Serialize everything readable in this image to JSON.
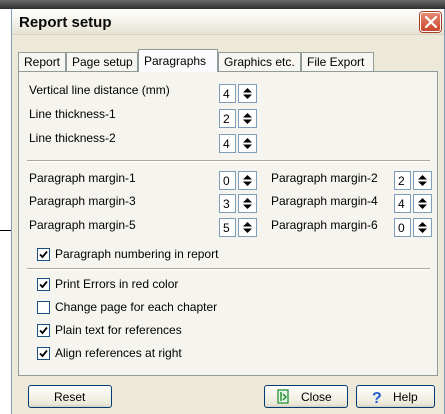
{
  "window": {
    "title": "Report setup"
  },
  "tabs": [
    {
      "label": "Report"
    },
    {
      "label": "Page setup"
    },
    {
      "label": "Paragraphs"
    },
    {
      "label": "Graphics etc."
    },
    {
      "label": "File Export"
    }
  ],
  "line_settings": [
    {
      "label": "Vertical line distance (mm)",
      "value": "4"
    },
    {
      "label": "Line thickness-1",
      "value": "2"
    },
    {
      "label": "Line thickness-2",
      "value": "4"
    }
  ],
  "margins": [
    {
      "label": "Paragraph margin-1",
      "value": "0"
    },
    {
      "label": "Paragraph margin-2",
      "value": "2"
    },
    {
      "label": "Paragraph margin-3",
      "value": "3"
    },
    {
      "label": "Paragraph margin-4",
      "value": "4"
    },
    {
      "label": "Paragraph margin-5",
      "value": "5"
    },
    {
      "label": "Paragraph margin-6",
      "value": "0"
    }
  ],
  "numbering": {
    "label": "Paragraph numbering in report",
    "checked": true
  },
  "options": [
    {
      "label": "Print Errors in red color",
      "checked": true
    },
    {
      "label": "Change page for each chapter",
      "checked": false
    },
    {
      "label": "Plain text for references",
      "checked": true
    },
    {
      "label": "Align references at right",
      "checked": true
    }
  ],
  "buttons": {
    "reset": "Reset",
    "close": "Close",
    "help": "Help"
  },
  "colors": {
    "close_icon": "#1a8a2a",
    "help_icon": "#1f5fd1",
    "title_close": "#c8462c"
  }
}
